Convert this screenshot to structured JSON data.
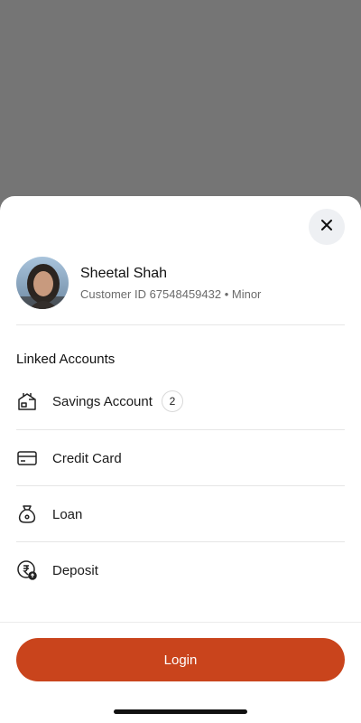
{
  "profile": {
    "name": "Sheetal Shah",
    "meta": "Customer ID 67548459432 • Minor"
  },
  "linked_accounts": {
    "title": "Linked Accounts",
    "items": [
      {
        "label": "Savings Account",
        "icon": "bank-icon",
        "badge": "2"
      },
      {
        "label": "Credit Card",
        "icon": "credit-card-icon"
      },
      {
        "label": "Loan",
        "icon": "money-bag-icon"
      },
      {
        "label": "Deposit",
        "icon": "rupee-deposit-icon"
      }
    ]
  },
  "actions": {
    "close_icon": "close-icon",
    "login_label": "Login"
  },
  "colors": {
    "accent": "#c9441c",
    "overlay": "#757575",
    "close_bg": "#eef0f3"
  }
}
